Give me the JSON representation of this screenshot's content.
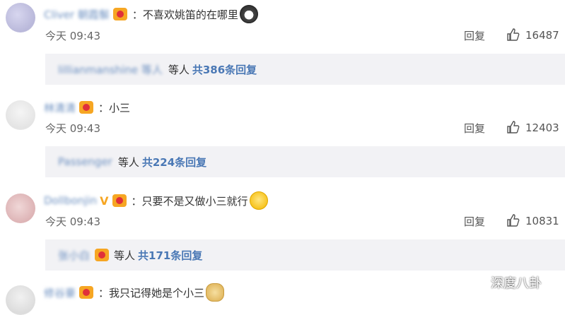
{
  "comments": [
    {
      "username": "Cliver 朝霞鬃",
      "text": "：不喜欢姚笛的在哪里",
      "emoji": "husky-emoji",
      "time": "今天 09:43",
      "reply_label": "回复",
      "likes": "16487",
      "sub": {
        "names": "lillianmanshine 等人",
        "wait": "等人",
        "more": "共386条回复"
      }
    },
    {
      "username": "林清清",
      "text": "：小三",
      "emoji": "",
      "time": "今天 09:43",
      "reply_label": "回复",
      "likes": "12403",
      "sub": {
        "names": "Passenger",
        "wait": "等人",
        "more": "共224条回复"
      }
    },
    {
      "username": "Dollbonjin",
      "text": "：只要不是又做小三就行",
      "emoji": "smile-emoji",
      "time": "今天 09:43",
      "reply_label": "回复",
      "likes": "10831",
      "sub": {
        "names": "张小白",
        "wait": "等人",
        "more": "共171条回复"
      }
    },
    {
      "username": "修谷豪",
      "text": "：我只记得她是个小三",
      "emoji": "doge-emoji"
    }
  ],
  "watermark": {
    "text": "深度八卦"
  },
  "colors": {
    "link": "#4a78b5",
    "sub_bg": "#f2f2f5",
    "vip": "#f6a623"
  }
}
